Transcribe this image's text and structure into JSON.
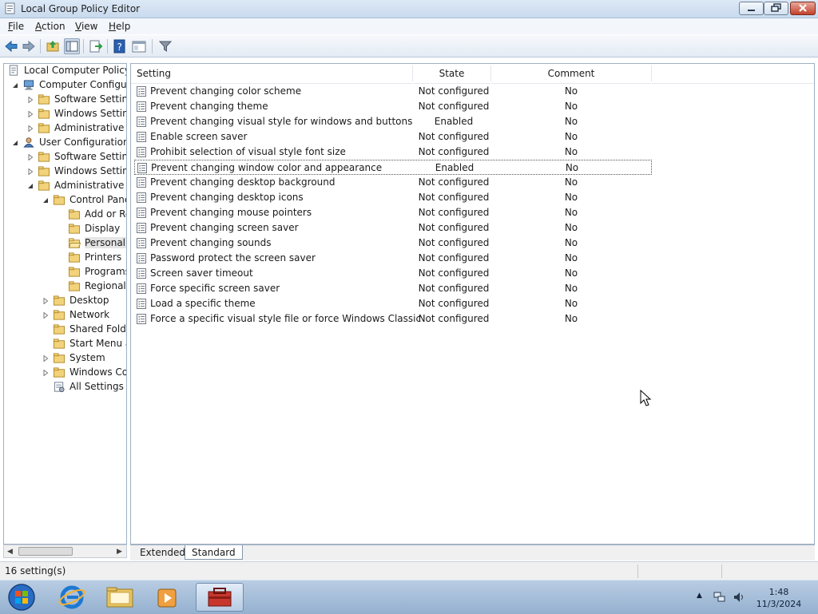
{
  "window": {
    "title": "Local Group Policy Editor",
    "buttons": [
      "minimize",
      "maximize",
      "close"
    ]
  },
  "menubar": {
    "items": [
      {
        "label": "File",
        "accel": "F",
        "rest": "ile"
      },
      {
        "label": "Action",
        "accel": "A",
        "rest": "ction"
      },
      {
        "label": "View",
        "accel": "V",
        "rest": "iew"
      },
      {
        "label": "Help",
        "accel": "H",
        "rest": "elp"
      }
    ]
  },
  "toolbar": {
    "buttons": [
      "back-icon",
      "forward-icon",
      "up-folder-icon",
      "show-hide-console-tree-icon",
      "export-list-icon",
      "help-icon",
      "properties-icon",
      "filter-icon"
    ]
  },
  "tree": {
    "nodes": [
      {
        "label": "Local Computer Policy",
        "icon": "policy-document-icon",
        "level": 0,
        "toggle": "none"
      },
      {
        "label": "Computer Configura",
        "icon": "computer-icon",
        "level": 1,
        "toggle": "expanded"
      },
      {
        "label": "Software Settings",
        "icon": "folder-icon",
        "level": 2,
        "toggle": "collapsed"
      },
      {
        "label": "Windows Setting",
        "icon": "folder-icon",
        "level": 2,
        "toggle": "collapsed"
      },
      {
        "label": "Administrative Te",
        "icon": "folder-icon",
        "level": 2,
        "toggle": "collapsed"
      },
      {
        "label": "User Configuration",
        "icon": "user-icon",
        "level": 1,
        "toggle": "expanded"
      },
      {
        "label": "Software Settings",
        "icon": "folder-icon",
        "level": 2,
        "toggle": "collapsed"
      },
      {
        "label": "Windows Setting",
        "icon": "folder-icon",
        "level": 2,
        "toggle": "collapsed"
      },
      {
        "label": "Administrative Te",
        "icon": "folder-icon",
        "level": 2,
        "toggle": "expanded"
      },
      {
        "label": "Control Panel",
        "icon": "folder-icon",
        "level": 3,
        "toggle": "expanded"
      },
      {
        "label": "Add or Re",
        "icon": "folder-icon",
        "level": 4,
        "toggle": "none"
      },
      {
        "label": "Display",
        "icon": "folder-icon",
        "level": 4,
        "toggle": "none"
      },
      {
        "label": "Personaliz",
        "icon": "folder-open-icon",
        "level": 4,
        "toggle": "none",
        "selected": true
      },
      {
        "label": "Printers",
        "icon": "folder-icon",
        "level": 4,
        "toggle": "none"
      },
      {
        "label": "Programs",
        "icon": "folder-icon",
        "level": 4,
        "toggle": "none"
      },
      {
        "label": "Regional a",
        "icon": "folder-icon",
        "level": 4,
        "toggle": "none"
      },
      {
        "label": "Desktop",
        "icon": "folder-icon",
        "level": 3,
        "toggle": "collapsed"
      },
      {
        "label": "Network",
        "icon": "folder-icon",
        "level": 3,
        "toggle": "collapsed"
      },
      {
        "label": "Shared Folder",
        "icon": "folder-icon",
        "level": 3,
        "toggle": "none"
      },
      {
        "label": "Start Menu ar",
        "icon": "folder-icon",
        "level": 3,
        "toggle": "none"
      },
      {
        "label": "System",
        "icon": "folder-icon",
        "level": 3,
        "toggle": "collapsed"
      },
      {
        "label": "Windows Cor",
        "icon": "folder-icon",
        "level": 3,
        "toggle": "collapsed"
      },
      {
        "label": "All Settings",
        "icon": "all-settings-icon",
        "level": 3,
        "toggle": "none"
      }
    ]
  },
  "list": {
    "columns": {
      "setting": "Setting",
      "state": "State",
      "comment": "Comment"
    },
    "rows": [
      {
        "setting": "Prevent changing color scheme",
        "state": "Not configured",
        "comment": "No"
      },
      {
        "setting": "Prevent changing theme",
        "state": "Not configured",
        "comment": "No"
      },
      {
        "setting": "Prevent changing visual style for windows and buttons",
        "state": "Enabled",
        "comment": "No"
      },
      {
        "setting": "Enable screen saver",
        "state": "Not configured",
        "comment": "No"
      },
      {
        "setting": "Prohibit selection of visual style font size",
        "state": "Not configured",
        "comment": "No"
      },
      {
        "setting": "Prevent changing window color and appearance",
        "state": "Enabled",
        "comment": "No",
        "focused": true
      },
      {
        "setting": "Prevent changing desktop background",
        "state": "Not configured",
        "comment": "No"
      },
      {
        "setting": "Prevent changing desktop icons",
        "state": "Not configured",
        "comment": "No"
      },
      {
        "setting": "Prevent changing mouse pointers",
        "state": "Not configured",
        "comment": "No"
      },
      {
        "setting": "Prevent changing screen saver",
        "state": "Not configured",
        "comment": "No"
      },
      {
        "setting": "Prevent changing sounds",
        "state": "Not configured",
        "comment": "No"
      },
      {
        "setting": "Password protect the screen saver",
        "state": "Not configured",
        "comment": "No"
      },
      {
        "setting": "Screen saver timeout",
        "state": "Not configured",
        "comment": "No"
      },
      {
        "setting": "Force specific screen saver",
        "state": "Not configured",
        "comment": "No"
      },
      {
        "setting": "Load a specific theme",
        "state": "Not configured",
        "comment": "No"
      },
      {
        "setting": "Force a specific visual style file or force Windows Classic",
        "state": "Not configured",
        "comment": "No"
      }
    ]
  },
  "tabs": [
    {
      "label": "Extended",
      "active": false
    },
    {
      "label": "Standard",
      "active": true
    }
  ],
  "status": {
    "text": "16 setting(s)"
  },
  "taskbar": {
    "items": [
      "start-orb-icon",
      "internet-explorer-icon",
      "file-explorer-icon",
      "media-player-icon",
      "group-policy-editor-icon"
    ],
    "active_item": "group-policy-editor-icon",
    "clock": {
      "time": "1:48",
      "date": "11/3/2024"
    }
  },
  "colors": {
    "accent": "#3a6ea5",
    "selection": "#e5e5e5",
    "titlebar": "#c9daee",
    "taskbar": "#a6bfdb"
  }
}
